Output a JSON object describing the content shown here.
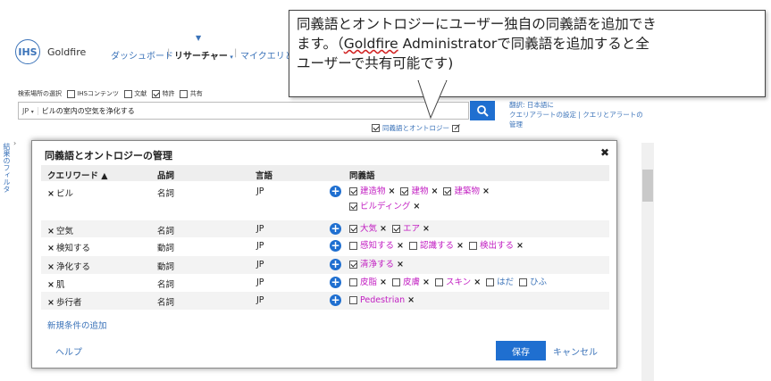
{
  "header": {
    "logo": "IHS",
    "brand": "Goldfire",
    "nav": [
      {
        "label": "ダッシュボード",
        "dark": false
      },
      {
        "label": "リサーチャー",
        "dark": true
      },
      {
        "label": "マイクエリとア",
        "dark": false
      }
    ]
  },
  "search": {
    "source_label": "検索場所の選択",
    "sources": [
      {
        "label": "IHSコンテンツ",
        "checked": false
      },
      {
        "label": "文献",
        "checked": false
      },
      {
        "label": "特許",
        "checked": true
      },
      {
        "label": "共有",
        "checked": false
      }
    ],
    "lang": "JP",
    "query": "ビルの室内の空気を浄化する",
    "ontology_label": "同義語とオントロジー",
    "right_links": [
      "翻訳: 日本語に",
      "クエリアラートの設定 | クエリとアラートの",
      "管理"
    ]
  },
  "side_filter": "結果のフィルタ",
  "callout": {
    "line1": "同義語とオントロジーにユーザー独自の同義語を追加でき",
    "line2a": "ます。（",
    "line2b": "Goldfire",
    "line2c": " Administratorで同義語を追加すると全",
    "line3": "ユーザーで共有可能です)"
  },
  "dialog": {
    "title": "同義語とオントロジーの管理",
    "columns": {
      "keyword": "クエリワード ▲",
      "pos": "品詞",
      "lang": "言語",
      "synonyms": "同義語"
    },
    "rows": [
      {
        "keyword": "ビル",
        "pos": "名詞",
        "lang": "JP",
        "synonyms": [
          [
            {
              "label": "建造物",
              "checked": true
            },
            {
              "label": "建物",
              "checked": true
            },
            {
              "label": "建築物",
              "checked": true
            }
          ],
          [
            {
              "label": "ビルディング",
              "checked": true
            }
          ]
        ]
      },
      {
        "keyword": "空気",
        "pos": "名詞",
        "lang": "JP",
        "synonyms": [
          [
            {
              "label": "大気",
              "checked": true
            },
            {
              "label": "エア",
              "checked": true
            }
          ]
        ]
      },
      {
        "keyword": "検知する",
        "pos": "動詞",
        "lang": "JP",
        "synonyms": [
          [
            {
              "label": "感知する",
              "checked": false
            },
            {
              "label": "認識する",
              "checked": false
            },
            {
              "label": "検出する",
              "checked": false
            }
          ]
        ]
      },
      {
        "keyword": "浄化する",
        "pos": "動詞",
        "lang": "JP",
        "synonyms": [
          [
            {
              "label": "清浄する",
              "checked": true
            }
          ]
        ]
      },
      {
        "keyword": "肌",
        "pos": "名詞",
        "lang": "JP",
        "synonyms": [
          [
            {
              "label": "皮脂",
              "checked": false
            },
            {
              "label": "皮膚",
              "checked": false
            },
            {
              "label": "スキン",
              "checked": false
            },
            {
              "label": "はだ",
              "checked": false,
              "blue": true
            },
            {
              "label": "ひふ",
              "checked": false,
              "blue": true
            }
          ]
        ]
      },
      {
        "keyword": "歩行者",
        "pos": "名詞",
        "lang": "JP",
        "synonyms": [
          [
            {
              "label": "Pedestrian",
              "checked": false
            }
          ]
        ]
      }
    ],
    "add_condition": "新規条件の追加",
    "help": "ヘルプ",
    "save": "保存",
    "cancel": "キャンセル"
  },
  "colors": {
    "accent": "#1f6fd0",
    "link": "#3b73b9",
    "synonym": "#c21fc2"
  }
}
